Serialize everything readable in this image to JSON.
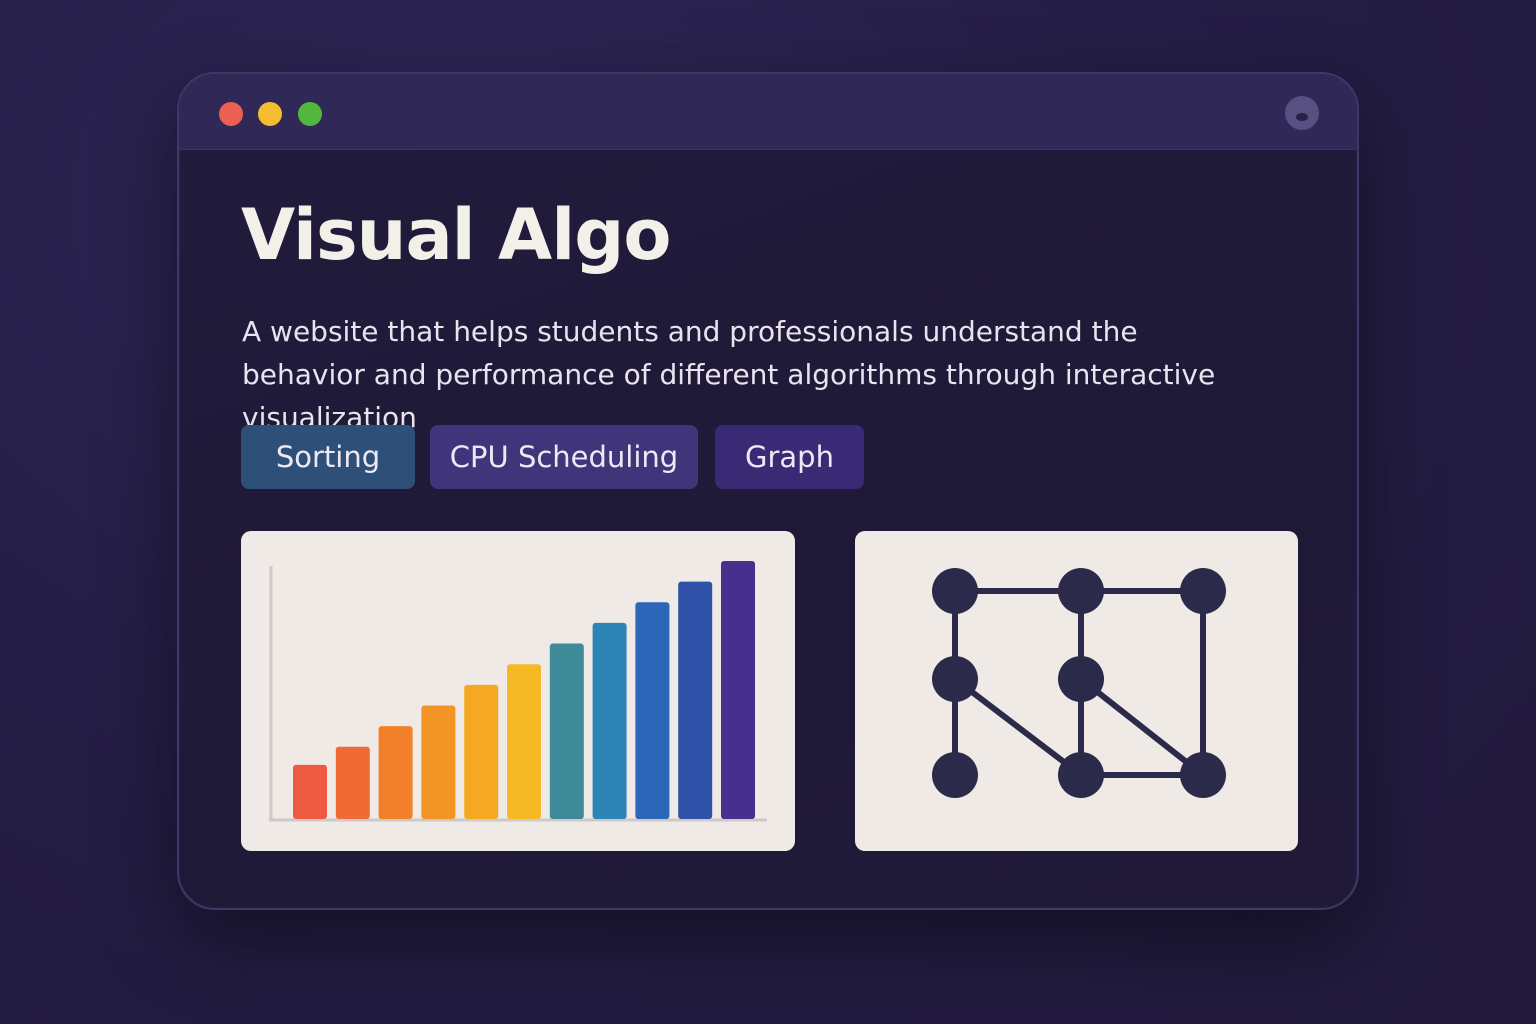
{
  "window": {
    "title": "Visual Algo",
    "description": "A website that helps students and professionals understand the behavior and performance of different algorithms through interactive visualization"
  },
  "tabs": [
    {
      "label": "Sorting",
      "color": "#2e5078"
    },
    {
      "label": "CPU Scheduling",
      "color": "#40357a"
    },
    {
      "label": "Graph",
      "color": "#3a2a75"
    }
  ],
  "window_controls": {
    "close_color": "#ec6052",
    "minimize_color": "#f3bd2f",
    "maximize_color": "#52b83d"
  },
  "chart_data": {
    "type": "bar",
    "title": "",
    "xlabel": "",
    "ylabel": "",
    "values": [
      2.1,
      2.8,
      3.6,
      4.4,
      5.2,
      6.0,
      6.8,
      7.6,
      8.4,
      9.2,
      10.0
    ],
    "colors": [
      "#ee5a40",
      "#f06a35",
      "#f2802a",
      "#f39526",
      "#f5a822",
      "#f6b926",
      "#3d8a99",
      "#2e84b6",
      "#2b66b8",
      "#2f52a8",
      "#46308e"
    ],
    "ylim": [
      0,
      10
    ],
    "grid": false
  },
  "graph_data": {
    "nodes": [
      {
        "id": "n1"
      },
      {
        "id": "n2"
      },
      {
        "id": "n3"
      },
      {
        "id": "n4"
      },
      {
        "id": "n5"
      },
      {
        "id": "n6"
      },
      {
        "id": "n7"
      },
      {
        "id": "n8"
      }
    ],
    "edges": [
      [
        "n1",
        "n2"
      ],
      [
        "n2",
        "n3"
      ],
      [
        "n1",
        "n4"
      ],
      [
        "n4",
        "n6"
      ],
      [
        "n2",
        "n5"
      ],
      [
        "n5",
        "n7"
      ],
      [
        "n3",
        "n8"
      ],
      [
        "n4",
        "n7"
      ],
      [
        "n5",
        "n8"
      ],
      [
        "n7",
        "n8"
      ]
    ],
    "node_color": "#2b2a4a",
    "edge_color": "#2b2a4a"
  }
}
